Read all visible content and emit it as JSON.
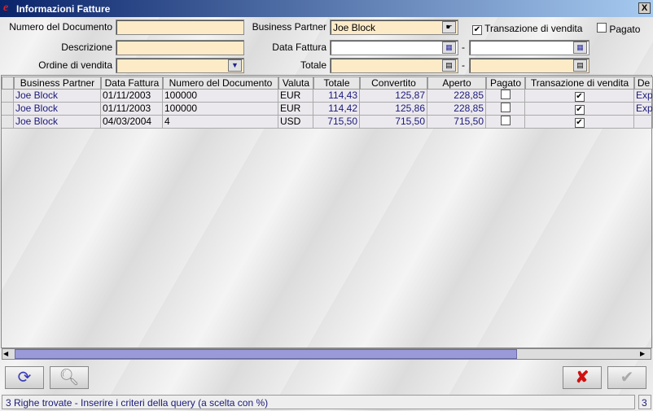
{
  "window": {
    "title": "Informazioni Fatture",
    "close_label": "X"
  },
  "filters": {
    "document_number": {
      "label": "Numero del Documento",
      "value": ""
    },
    "description": {
      "label": "Descrizione",
      "value": ""
    },
    "sales_order": {
      "label": "Ordine di vendita",
      "value": ""
    },
    "business_partner": {
      "label": "Business Partner",
      "value": "Joe Block"
    },
    "invoice_date": {
      "label": "Data Fattura",
      "from": "",
      "to": "",
      "separator": "-"
    },
    "total": {
      "label": "Totale",
      "from": "",
      "to": "",
      "separator": "-"
    },
    "sales_transaction": {
      "label": "Transazione di vendita",
      "checked": true
    },
    "paid": {
      "label": "Pagato",
      "checked": false
    }
  },
  "table": {
    "columns": [
      "Business Partner",
      "Data Fattura",
      "Numero del Documento",
      "Valuta",
      "Totale",
      "Convertito",
      "Aperto",
      "Pagato",
      "Transazione di vendita",
      "De"
    ],
    "rows": [
      {
        "bp": "Joe Block",
        "date": "01/11/2003",
        "doc": "100000",
        "currency": "EUR",
        "total": "114,43",
        "converted": "125,87",
        "open": "228,85",
        "paid": false,
        "sales": true,
        "desc": "Exp"
      },
      {
        "bp": "Joe Block",
        "date": "01/11/2003",
        "doc": "100000",
        "currency": "EUR",
        "total": "114,42",
        "converted": "125,86",
        "open": "228,85",
        "paid": false,
        "sales": true,
        "desc": "Exp"
      },
      {
        "bp": "Joe Block",
        "date": "04/03/2004",
        "doc": "4",
        "currency": "USD",
        "total": "715,50",
        "converted": "715,50",
        "open": "715,50",
        "paid": false,
        "sales": true,
        "desc": ""
      }
    ]
  },
  "status": {
    "message": "3 Righe trovate - Inserire i criteri della query (a scelta con %)",
    "count": "3"
  },
  "colors": {
    "field_bg": "#fdebc8",
    "title_start": "#0a246a",
    "title_end": "#a6caf0",
    "scroll_thumb": "#9a9ad8"
  }
}
